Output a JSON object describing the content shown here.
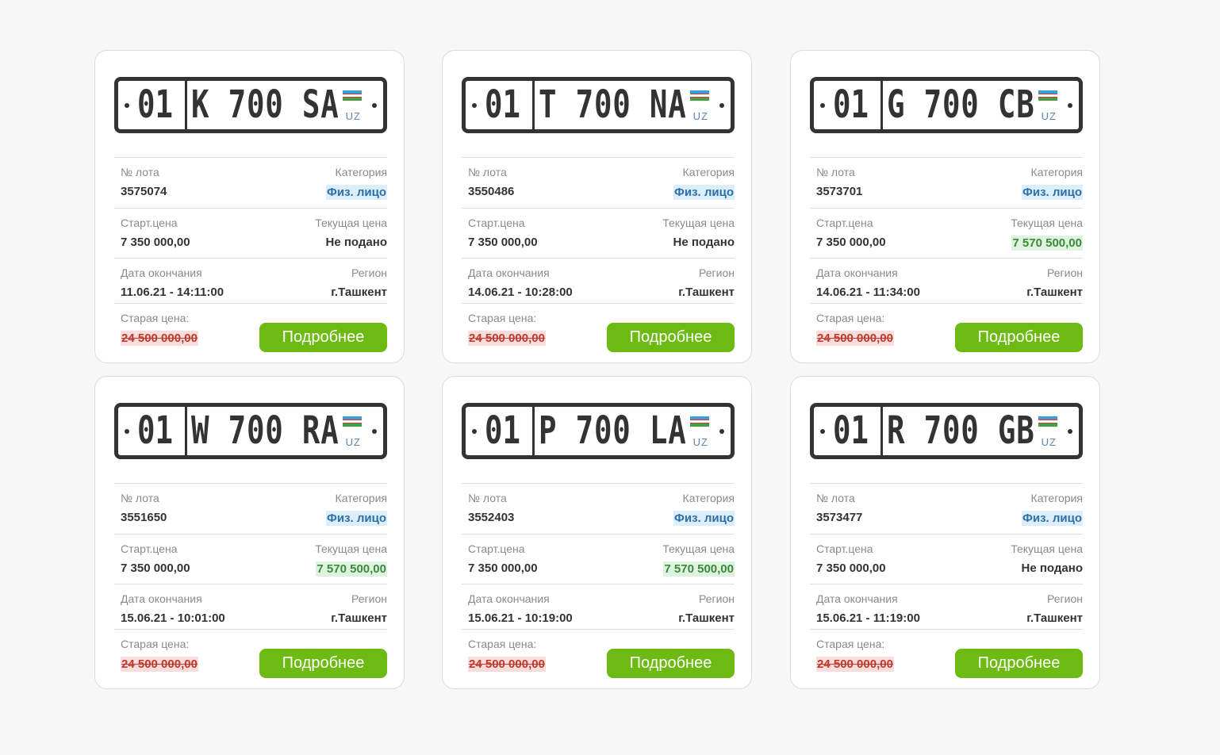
{
  "labels": {
    "lot": "№ лота",
    "category": "Категория",
    "start_price": "Старт.цена",
    "current_price": "Текущая цена",
    "end_date": "Дата окончания",
    "region": "Регион",
    "old_price": "Старая цена:",
    "details_button": "Подробнее",
    "plate_country": "UZ"
  },
  "colors": {
    "button": "#6dbb12",
    "category_bg": "#dbeefa",
    "price_bg": "#dff2df",
    "old_price_bg": "#f9dcdc"
  },
  "lots": [
    {
      "plate_region": "01",
      "plate_number": "K 700 SA",
      "lot": "3575074",
      "category": "Физ. лицо",
      "start_price": "7 350 000,00",
      "current_price": "Не подано",
      "current_has_bid": false,
      "end_date": "11.06.21 - 14:11:00",
      "region": "г.Ташкент",
      "old_price": "24 500 000,00"
    },
    {
      "plate_region": "01",
      "plate_number": "T 700 NA",
      "lot": "3550486",
      "category": "Физ. лицо",
      "start_price": "7 350 000,00",
      "current_price": "Не подано",
      "current_has_bid": false,
      "end_date": "14.06.21 - 10:28:00",
      "region": "г.Ташкент",
      "old_price": "24 500 000,00"
    },
    {
      "plate_region": "01",
      "plate_number": "G 700 CB",
      "lot": "3573701",
      "category": "Физ. лицо",
      "start_price": "7 350 000,00",
      "current_price": "7 570 500,00",
      "current_has_bid": true,
      "end_date": "14.06.21 - 11:34:00",
      "region": "г.Ташкент",
      "old_price": "24 500 000,00"
    },
    {
      "plate_region": "01",
      "plate_number": "W 700 RA",
      "lot": "3551650",
      "category": "Физ. лицо",
      "start_price": "7 350 000,00",
      "current_price": "7 570 500,00",
      "current_has_bid": true,
      "end_date": "15.06.21 - 10:01:00",
      "region": "г.Ташкент",
      "old_price": "24 500 000,00"
    },
    {
      "plate_region": "01",
      "plate_number": "P 700 LA",
      "lot": "3552403",
      "category": "Физ. лицо",
      "start_price": "7 350 000,00",
      "current_price": "7 570 500,00",
      "current_has_bid": true,
      "end_date": "15.06.21 - 10:19:00",
      "region": "г.Ташкент",
      "old_price": "24 500 000,00"
    },
    {
      "plate_region": "01",
      "plate_number": "R 700 GB",
      "lot": "3573477",
      "category": "Физ. лицо",
      "start_price": "7 350 000,00",
      "current_price": "Не подано",
      "current_has_bid": false,
      "end_date": "15.06.21 - 11:19:00",
      "region": "г.Ташкент",
      "old_price": "24 500 000,00"
    }
  ]
}
